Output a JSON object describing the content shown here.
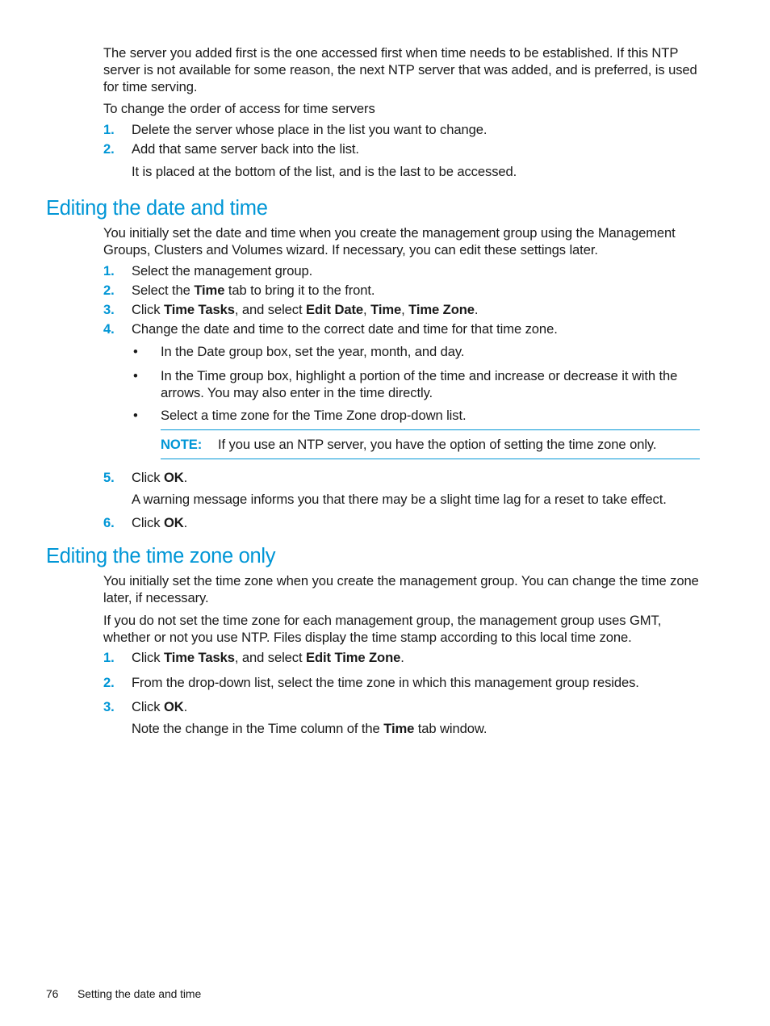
{
  "intro": {
    "paragraph1": "The server you added first is the one accessed first when time needs to be established. If this NTP server is not available for some reason, the next NTP server that was added, and is preferred, is used for time serving.",
    "paragraph2": "To change the order of access for time servers",
    "steps": [
      {
        "num": "1.",
        "text": "Delete the server whose place in the list you want to change."
      },
      {
        "num": "2.",
        "text": "Add that same server back into the list."
      }
    ],
    "step2_note": "It is placed at the bottom of the list, and is the last to be accessed."
  },
  "section1": {
    "heading": "Editing the date and time",
    "paragraph": "You initially set the date and time when you create the management group using the Management Groups, Clusters and Volumes wizard. If necessary, you can edit these settings later.",
    "steps": [
      {
        "num": "1.",
        "text": "Select the management group."
      },
      {
        "num": "2.",
        "pre": "Select the ",
        "bold": "Time",
        "post": " tab to bring it to the front."
      },
      {
        "num": "3.",
        "pre": "Click ",
        "bold1": "Time Tasks",
        "mid": ", and select ",
        "bold2": "Edit Date",
        "sep1": ", ",
        "bold3": "Time",
        "sep2": ", ",
        "bold4": "Time Zone",
        "post": "."
      },
      {
        "num": "4.",
        "text": "Change the date and time to the correct date and time for that time zone."
      },
      {
        "num": "5.",
        "pre": "Click ",
        "bold": "OK",
        "post": "."
      },
      {
        "num": "6.",
        "pre": "Click ",
        "bold": "OK",
        "post": "."
      }
    ],
    "bullets": [
      "In the Date group box, set the year, month, and day.",
      "In the Time group box, highlight a portion of the time and increase or decrease it with the arrows. You may also enter in the time directly.",
      "Select a time zone for the Time Zone drop-down list."
    ],
    "bullet_symbol": "•",
    "note": {
      "label": "NOTE:",
      "text": "If you use an NTP server, you have the option of setting the time zone only."
    },
    "step5_note": "A warning message informs you that there may be a slight time lag for a reset to take effect."
  },
  "section2": {
    "heading": "Editing the time zone only",
    "paragraph1": "You initially set the time zone when you create the management group. You can change the time zone later, if necessary.",
    "paragraph2": "If you do not set the time zone for each management group, the management group uses GMT, whether or not you use NTP. Files display the time stamp according to this local time zone.",
    "steps": [
      {
        "num": "1.",
        "pre": "Click ",
        "bold1": "Time Tasks",
        "mid": ", and select ",
        "bold2": "Edit Time Zone",
        "post": "."
      },
      {
        "num": "2.",
        "text": "From the drop-down list, select the time zone in which this management group resides."
      },
      {
        "num": "3.",
        "pre": "Click ",
        "bold": "OK",
        "post": "."
      }
    ],
    "step3_note_pre": "Note the change in the Time column of the ",
    "step3_note_bold": "Time",
    "step3_note_post": " tab window."
  },
  "footer": {
    "page_number": "76",
    "section_title": "Setting the date and time"
  },
  "colors": {
    "accent": "#0096d6",
    "text": "#1a1a1a"
  }
}
